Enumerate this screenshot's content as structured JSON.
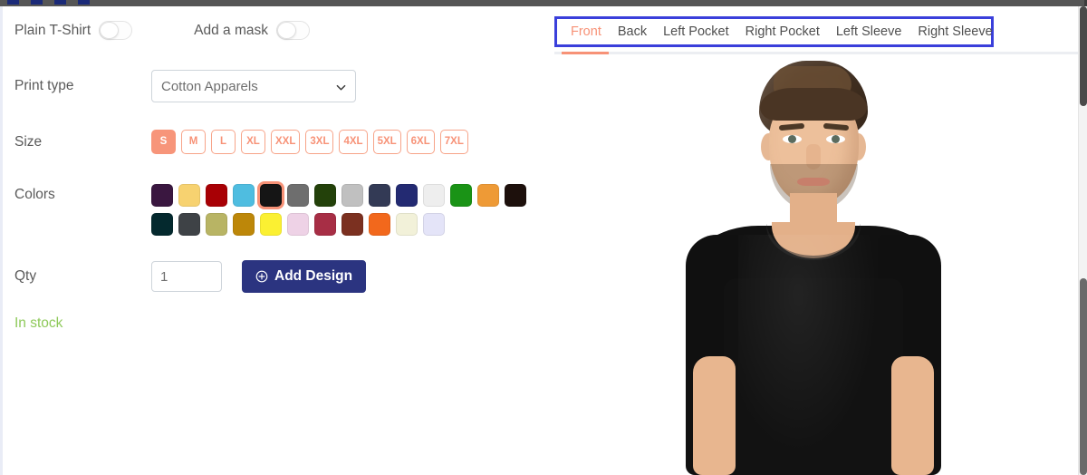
{
  "toggles": [
    {
      "label": "Plain T-Shirt",
      "name": "plain-tshirt-toggle",
      "state": "off"
    },
    {
      "label": "Add a mask",
      "name": "add-a-mask-toggle",
      "state": "off"
    }
  ],
  "print_type": {
    "label": "Print type",
    "selected": "Cotton Apparels",
    "options": [
      "Cotton Apparels"
    ]
  },
  "size": {
    "label": "Size",
    "options": [
      "S",
      "M",
      "L",
      "XL",
      "XXL",
      "3XL",
      "4XL",
      "5XL",
      "6XL",
      "7XL"
    ],
    "selected": "S",
    "accent": "#f79277"
  },
  "colors": {
    "label": "Colors",
    "selected_index": 4,
    "row1": [
      "#3a1740",
      "#f7d270",
      "#a80005",
      "#4fbde0",
      "#151515",
      "#6e6e6e",
      "#23410a",
      "#c0c0c0",
      "#333a55",
      "#232a72",
      "#eeeeee",
      "#1a9316",
      "#ee9a36",
      "#1d100c"
    ],
    "row2": [
      "#04292e",
      "#3e4246",
      "#b8b464",
      "#bd8709",
      "#fbf032",
      "#eed2e6",
      "#a72e45",
      "#7b3020",
      "#f2681c",
      "#f2f1d9",
      "#e4e4f8"
    ]
  },
  "qty": {
    "label": "Qty",
    "value": "1",
    "placeholder": "1"
  },
  "add_design": {
    "label": "Add Design",
    "icon": "plus-circle-icon",
    "color": "#2b3480"
  },
  "stock": {
    "text": "In stock",
    "color": "#8ec95a"
  },
  "preview": {
    "tabs": [
      {
        "label": "Front",
        "active": true
      },
      {
        "label": "Back",
        "active": false
      },
      {
        "label": "Left Pocket",
        "active": false
      },
      {
        "label": "Right Pocket",
        "active": false
      },
      {
        "label": "Left Sleeve",
        "active": false
      },
      {
        "label": "Right Sleeve",
        "active": false
      }
    ],
    "highlight_color": "#3a3fdb",
    "active_tab_color": "#f79277",
    "image_alt": "Male model wearing a plain black crew-neck t-shirt"
  }
}
